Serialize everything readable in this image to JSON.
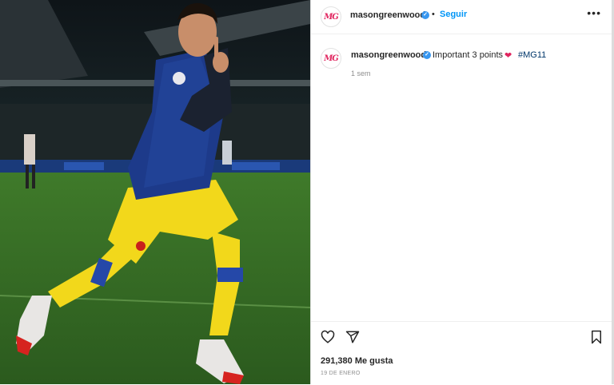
{
  "post": {
    "author": {
      "avatar_text": "MG",
      "username": "masongreenwood",
      "verified_mark": "✓"
    },
    "header": {
      "separator": "•",
      "follow_label": "Seguir",
      "more_label": "•••"
    },
    "caption": {
      "text": "Important 3 points",
      "emoji": "❤",
      "hashtag": "#MG11",
      "time_ago": "1 sem"
    },
    "likes": "291,380 Me gusta",
    "date": "19 DE ENERO",
    "icons": {
      "like": "heart-icon",
      "share": "paper-plane-icon",
      "save": "bookmark-icon",
      "more": "more-options-icon"
    }
  },
  "colors": {
    "follow_blue": "#0095f6",
    "verified_blue": "#3897f0",
    "brand_pink": "#e0245e"
  }
}
